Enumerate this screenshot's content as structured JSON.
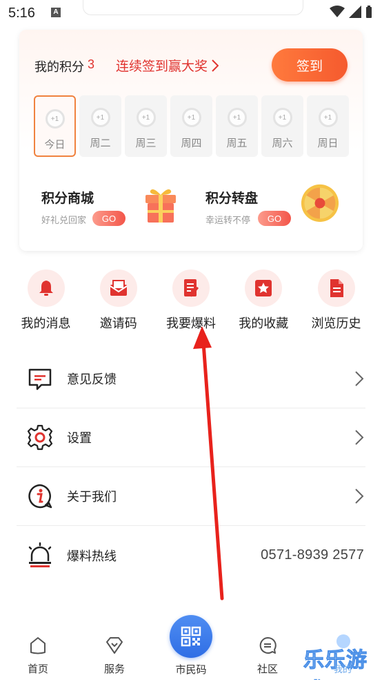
{
  "status_bar": {
    "time": "5:16",
    "notification_letter": "A"
  },
  "points": {
    "label": "我的积分",
    "value": "3",
    "promo": "连续签到赢大奖",
    "checkin_button": "签到",
    "days": [
      {
        "label": "今日",
        "reward": "+1",
        "active": true
      },
      {
        "label": "周二",
        "reward": "+1",
        "active": false
      },
      {
        "label": "周三",
        "reward": "+1",
        "active": false
      },
      {
        "label": "周四",
        "reward": "+1",
        "active": false
      },
      {
        "label": "周五",
        "reward": "+1",
        "active": false
      },
      {
        "label": "周六",
        "reward": "+1",
        "active": false
      },
      {
        "label": "周日",
        "reward": "+1",
        "active": false
      }
    ],
    "mall": {
      "title": "积分商城",
      "subtitle": "好礼兑回家",
      "go": "GO"
    },
    "wheel": {
      "title": "积分转盘",
      "subtitle": "幸运转不停",
      "go": "GO"
    }
  },
  "quick_actions": [
    {
      "label": "我的消息",
      "icon": "bell-icon"
    },
    {
      "label": "邀请码",
      "icon": "envelope-icon"
    },
    {
      "label": "我要爆料",
      "icon": "edit-document-icon"
    },
    {
      "label": "我的收藏",
      "icon": "star-icon"
    },
    {
      "label": "浏览历史",
      "icon": "history-document-icon"
    }
  ],
  "menu": [
    {
      "label": "意见反馈",
      "icon": "feedback-icon"
    },
    {
      "label": "设置",
      "icon": "gear-icon"
    },
    {
      "label": "关于我们",
      "icon": "info-icon"
    },
    {
      "label": "爆料热线",
      "icon": "alarm-icon",
      "value": "0571-8939 2577"
    }
  ],
  "bottom_nav": {
    "home": "首页",
    "service": "服务",
    "citizen_code": "市民码",
    "community": "社区",
    "mine": "我的"
  },
  "watermark": "乐乐游戏",
  "colors": {
    "accent_red": "#e0332f",
    "accent_orange": "#f55a2e",
    "nav_blue": "#2f6ee5"
  }
}
